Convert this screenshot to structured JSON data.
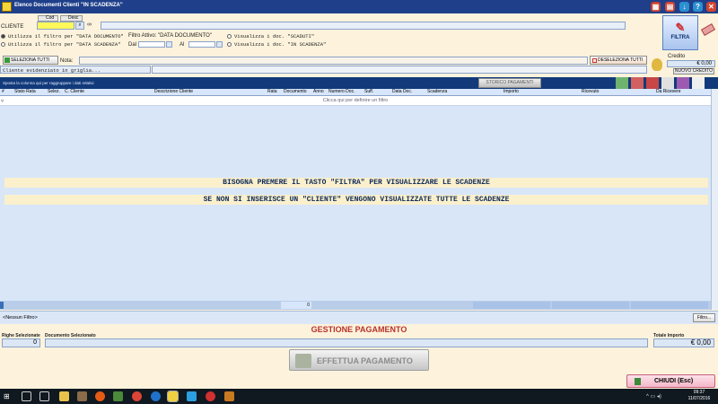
{
  "window": {
    "title": "Elenco Documenti Clienti \"IN SCADENZA\""
  },
  "filter": {
    "tab_cod": "Cod",
    "tab_desc": "Desc",
    "cliente_label": "CLIENTE",
    "cliente_value": "",
    "opt_data_documento": "Utilizza il filtro per \"DATA DOCUMENTO\"",
    "opt_data_scadenza": "Utilizza il filtro per \"DATA SCADENZA\"",
    "filtro_attivo": "Filtro Attivo: \"DATA DOCUMENTO\"",
    "dal_label": "Dal",
    "al_label": "Al",
    "opt_scaduti": "Visualizza i doc. \"SCADUTI\"",
    "opt_in_scadenza": "Visualizza i doc. \"IN SCADENZA\"",
    "filtra_label": "FILTRA"
  },
  "toolbar": {
    "seleziona_tutti": "SELEZIONA TUTTI",
    "nota_label": "Nota:",
    "cliente_evidenziato": "Cliente evidenziato in griglia...",
    "deseleziona_tutti": "DESELEZIONA TUTTI",
    "credito_label": "Credito",
    "credito_value": "€ 0,00",
    "nuovo_credito": "NUOVO CREDITO"
  },
  "grid": {
    "group_hint": "Sposta la colonna qui per raggruppare i dati relativi",
    "storico_pagamenti": "STORICO PAGAMENTI",
    "columns": [
      "#",
      "Stato Rata",
      "Selez.",
      "C. Cliente",
      "Descrizione Cliente",
      "Rata",
      "Documento",
      "Anno",
      "Numero Doc.",
      "Suff.",
      "Data Doc.",
      "Scadenza",
      "Importo",
      "Ricevuto",
      "Da Ricevere"
    ],
    "filter_row_hint": "Clicca qui per definire un filtro",
    "message_1": "BISOGNA PREMERE IL TASTO \"FILTRA\" PER VISUALIZZARE LE SCADENZE",
    "message_2": "SE NON SI INSERISCE UN \"CLIENTE\" VENGONO VISUALIZZATE TUTTE LE SCADENZE",
    "summary_count": "0",
    "no_filter": "<Nessun Filtro>",
    "filtro_button": "Filtro..."
  },
  "payment": {
    "section_title": "GESTIONE PAGAMENTO",
    "righe_label": "Righe Selezionate",
    "righe_value": "0",
    "documento_label": "Documento Selezionato",
    "documento_value": "",
    "totale_label": "Totale Importo",
    "totale_value": "€ 0,00",
    "effettua_pagamento": "EFFETTUA PAGAMENTO",
    "chiudi": "CHIUDI (Esc)"
  },
  "taskbar": {
    "time": "09:37",
    "date": "11/07/2016"
  },
  "colors": {
    "title_bar": "#1f3f8a",
    "panel_bg": "#fdf3dc",
    "grid_header": "#123a7a",
    "section_title": "#b8322a",
    "cliente_input": "#fff85a"
  }
}
